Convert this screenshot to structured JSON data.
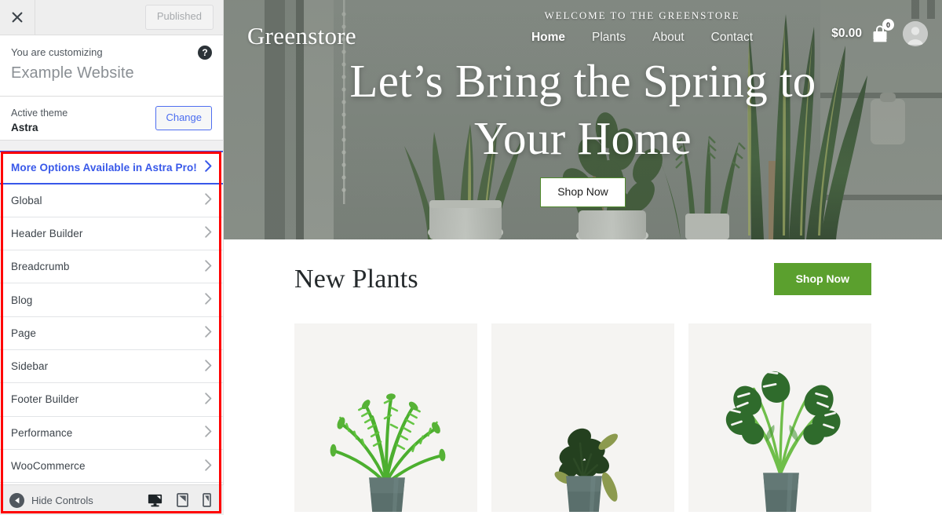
{
  "customizer": {
    "topbar": {
      "close_icon": "close-icon",
      "publish_label": "Published"
    },
    "customizing": {
      "label": "You are customizing",
      "site_title": "Example Website",
      "help_icon": "help-icon"
    },
    "active_theme": {
      "label": "Active theme",
      "name": "Astra",
      "change_label": "Change"
    },
    "pro_promo": {
      "label": "More Options Available in Astra Pro!",
      "arrow_icon": "chevron-right-icon",
      "accent_color": "#3858e9"
    },
    "items": [
      {
        "label": "Global",
        "arrow_icon": "chevron-right-icon"
      },
      {
        "label": "Header Builder",
        "arrow_icon": "chevron-right-icon"
      },
      {
        "label": "Breadcrumb",
        "arrow_icon": "chevron-right-icon"
      },
      {
        "label": "Blog",
        "arrow_icon": "chevron-right-icon"
      },
      {
        "label": "Page",
        "arrow_icon": "chevron-right-icon"
      },
      {
        "label": "Sidebar",
        "arrow_icon": "chevron-right-icon"
      },
      {
        "label": "Footer Builder",
        "arrow_icon": "chevron-right-icon"
      },
      {
        "label": "Performance",
        "arrow_icon": "chevron-right-icon"
      },
      {
        "label": "WooCommerce",
        "arrow_icon": "chevron-right-icon"
      }
    ],
    "footer": {
      "hide_controls_label": "Hide Controls",
      "collapse_icon": "collapse-left-icon",
      "devices": [
        {
          "name": "desktop-icon",
          "active": true
        },
        {
          "name": "tablet-icon",
          "active": false
        },
        {
          "name": "mobile-icon",
          "active": false
        }
      ]
    },
    "annotation": {
      "highlight_color": "#ff0000"
    }
  },
  "preview": {
    "header": {
      "brand": "Greenstore",
      "welcome": "WELCOME TO THE GREENSTORE",
      "nav": [
        {
          "label": "Home",
          "active": true
        },
        {
          "label": "Plants",
          "active": false
        },
        {
          "label": "About",
          "active": false
        },
        {
          "label": "Contact",
          "active": false
        }
      ],
      "cart": {
        "price": "$0.00",
        "count": "0",
        "icon": "shopping-bag-icon"
      },
      "account_icon": "user-avatar-icon"
    },
    "hero": {
      "title_line1": "Let’s Bring the Spring to",
      "title_line2": "Your Home",
      "cta_label": "Shop Now"
    },
    "section": {
      "title": "New Plants",
      "cta_label": "Shop Now",
      "cta_color": "#5ba02e",
      "cards": [
        {
          "name": "product-card-fern"
        },
        {
          "name": "product-card-peperomia"
        },
        {
          "name": "product-card-monstera"
        }
      ]
    }
  }
}
